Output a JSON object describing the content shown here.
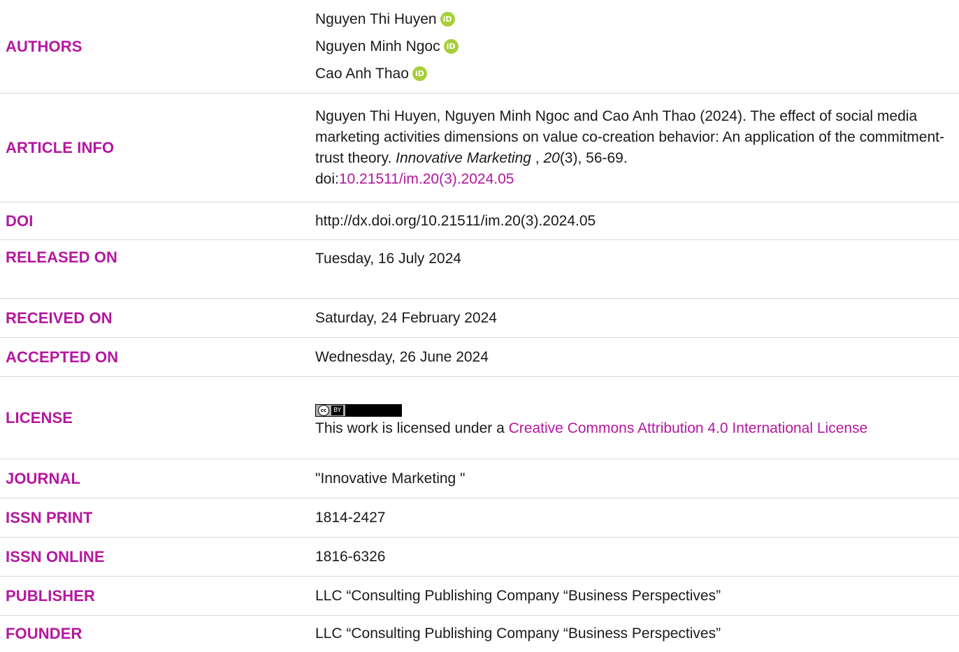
{
  "rows": {
    "authors": {
      "label": "AUTHORS",
      "names": [
        "Nguyen Thi Huyen",
        "Nguyen Minh Ngoc",
        "Cao Anh Thao"
      ],
      "orcid_glyph": "iD"
    },
    "article_info": {
      "label": "ARTICLE INFO",
      "citation_text": "Nguyen Thi Huyen, Nguyen Minh Ngoc and Cao Anh Thao (2024). The effect of social media marketing activities dimensions on value co-creation behavior: An application of the commitment-trust theory. ",
      "journal": "Innovative Marketing",
      "sep": " , ",
      "volume": "20",
      "issue_pages": "(3), 56-69.",
      "doi_prefix": "doi:",
      "doi_link": "10.21511/im.20(3).2024.05"
    },
    "doi": {
      "label": "DOI",
      "value": "http://dx.doi.org/10.21511/im.20(3).2024.05"
    },
    "released": {
      "label": "RELEASED ON",
      "value": "Tuesday, 16 July 2024"
    },
    "received": {
      "label": "RECEIVED ON",
      "value": "Saturday, 24 February 2024"
    },
    "accepted": {
      "label": "ACCEPTED ON",
      "value": "Wednesday, 26 June 2024"
    },
    "license": {
      "label": "LICENSE",
      "badge_cc": "cc",
      "badge_by": "BY",
      "text": "This work is licensed under a ",
      "link": "Creative Commons Attribution 4.0 International License"
    },
    "journal": {
      "label": "JOURNAL",
      "value": "\"Innovative Marketing \""
    },
    "issn_print": {
      "label": "ISSN PRINT",
      "value": "1814-2427"
    },
    "issn_online": {
      "label": "ISSN ONLINE",
      "value": "1816-6326"
    },
    "publisher": {
      "label": "PUBLISHER",
      "value": "LLC “Consulting Publishing Company “Business Perspectives”"
    },
    "founder": {
      "label": "FOUNDER",
      "value": "LLC “Consulting Publishing Company “Business Perspectives”"
    }
  },
  "colors": {
    "label": "#b5179e",
    "link": "#b5179e",
    "orcid": "#a6ce39",
    "divider": "#d9d9d9"
  }
}
